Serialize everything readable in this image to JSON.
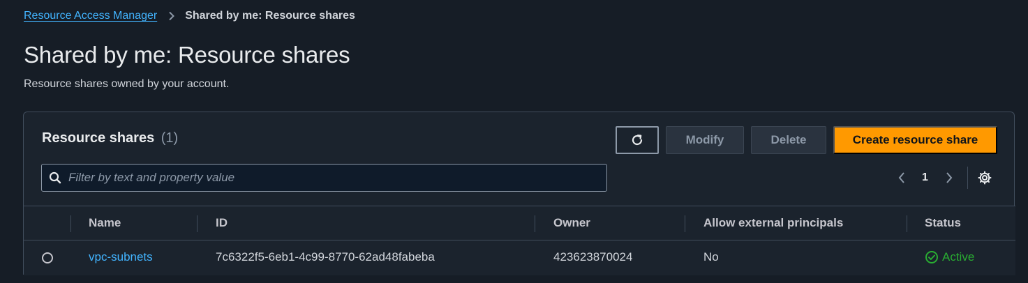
{
  "breadcrumb": {
    "parent": "Resource Access Manager",
    "current": "Shared by me: Resource shares"
  },
  "page": {
    "title": "Shared by me: Resource shares",
    "description": "Resource shares owned by your account."
  },
  "panel": {
    "heading": "Resource shares",
    "count": "(1)",
    "buttons": {
      "modify": "Modify",
      "delete": "Delete",
      "create": "Create resource share"
    },
    "search_placeholder": "Filter by text and property value",
    "pagination": {
      "current_page": "1"
    }
  },
  "table": {
    "columns": {
      "name": "Name",
      "id": "ID",
      "owner": "Owner",
      "allow_external": "Allow external principals",
      "status": "Status"
    },
    "rows": [
      {
        "name": "vpc-subnets",
        "id": "7c6322f5-6eb1-4c99-8770-62ad48fabeba",
        "owner": "423623870024",
        "allow_external": "No",
        "status": "Active"
      }
    ]
  },
  "colors": {
    "accent_link": "#42b4ff",
    "primary_button": "#ff9900",
    "status_active": "#29ad32",
    "background": "#161d26"
  }
}
